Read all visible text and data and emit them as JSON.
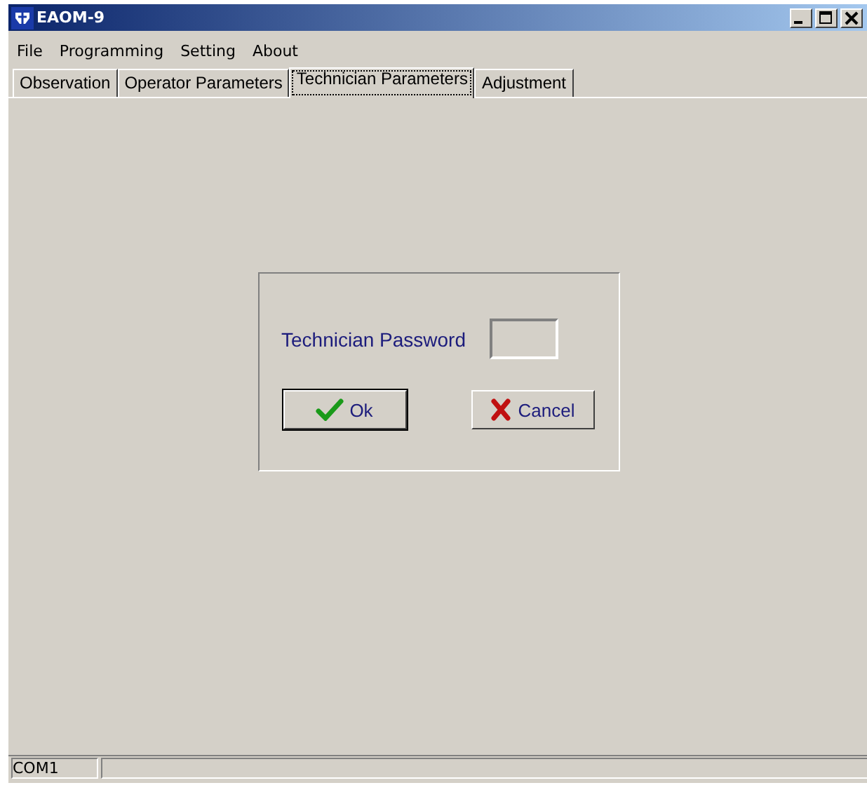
{
  "window": {
    "title": "EAOM-9"
  },
  "menu": [
    {
      "label": "File"
    },
    {
      "label": "Programming"
    },
    {
      "label": "Setting"
    },
    {
      "label": "About"
    }
  ],
  "tabs": [
    {
      "label": "Observation",
      "selected": false
    },
    {
      "label": "Operator Parameters",
      "selected": false
    },
    {
      "label": "Technician Parameters",
      "selected": true
    },
    {
      "label": "Adjustment",
      "selected": false
    }
  ],
  "login": {
    "label": "Technician Password",
    "ok": "Ok",
    "cancel": "Cancel"
  },
  "status_bar": {
    "port": "COM1"
  }
}
